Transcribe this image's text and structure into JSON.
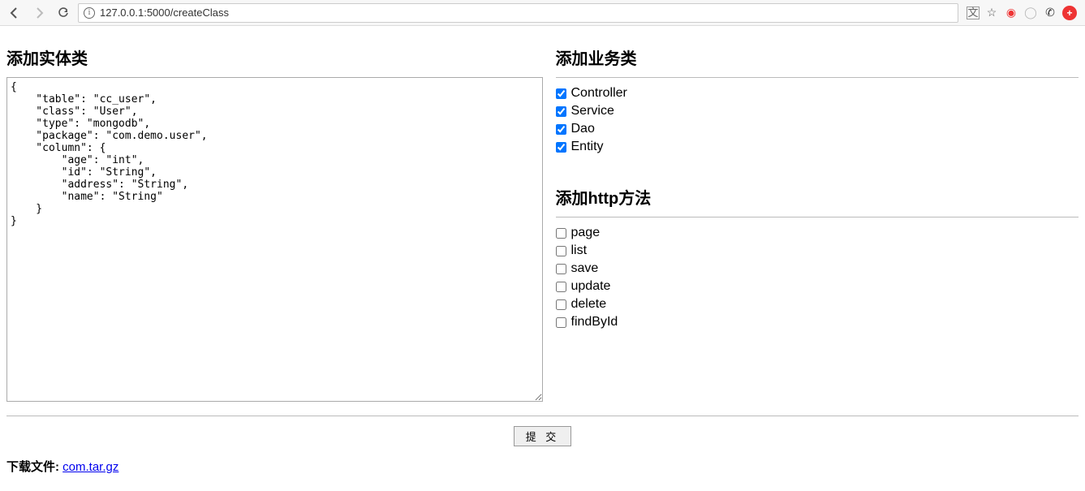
{
  "browser": {
    "url": "127.0.0.1:5000/createClass"
  },
  "left": {
    "heading": "添加实体类",
    "json_text": "{\n    \"table\": \"cc_user\",\n    \"class\": \"User\",\n    \"type\": \"mongodb\",\n    \"package\": \"com.demo.user\",\n    \"column\": {\n        \"age\": \"int\",\n        \"id\": \"String\",\n        \"address\": \"String\",\n        \"name\": \"String\"\n    }\n}"
  },
  "business": {
    "heading": "添加业务类",
    "items": [
      {
        "label": "Controller",
        "checked": true
      },
      {
        "label": "Service",
        "checked": true
      },
      {
        "label": "Dao",
        "checked": true
      },
      {
        "label": "Entity",
        "checked": true
      }
    ]
  },
  "http": {
    "heading": "添加http方法",
    "items": [
      {
        "label": "page",
        "checked": false
      },
      {
        "label": "list",
        "checked": false
      },
      {
        "label": "save",
        "checked": false
      },
      {
        "label": "update",
        "checked": false
      },
      {
        "label": "delete",
        "checked": false
      },
      {
        "label": "findById",
        "checked": false
      }
    ]
  },
  "submit_label": "提 交",
  "download": {
    "label": "下载文件: ",
    "link_text": "com.tar.gz"
  }
}
